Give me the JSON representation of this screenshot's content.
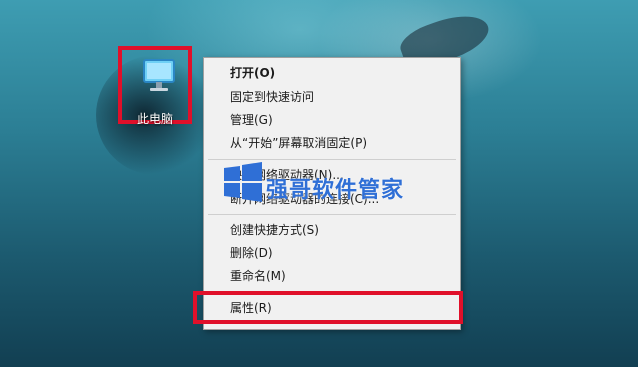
{
  "desktop": {
    "icon_label": "此电脑"
  },
  "menu": {
    "items": [
      {
        "label": "打开(O)",
        "bold": true
      },
      {
        "label": "固定到快速访问"
      },
      {
        "label": "管理(G)"
      },
      {
        "label": "从“开始”屏幕取消固定(P)"
      },
      {
        "label": "映射网络驱动器(N)..."
      },
      {
        "label": "断开网络驱动器的连接(C)..."
      },
      {
        "label": "创建快捷方式(S)"
      },
      {
        "label": "删除(D)"
      },
      {
        "label": "重命名(M)"
      },
      {
        "label": "属性(R)"
      }
    ]
  },
  "watermark": {
    "text": "强哥软件管家"
  },
  "colors": {
    "highlight": "#e0102a",
    "menu_bg": "#f1f1f1",
    "watermark_blue": "#2f6fd6"
  },
  "icons": [
    "this-pc-icon",
    "windows-logo-icon"
  ]
}
